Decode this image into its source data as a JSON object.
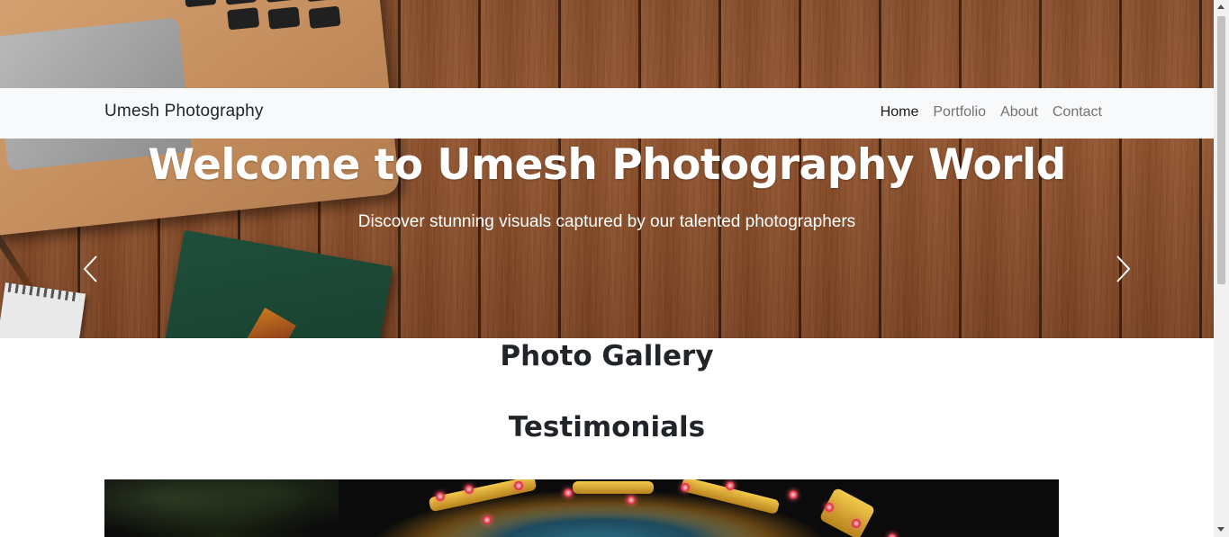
{
  "navbar": {
    "brand": "Umesh Photography",
    "links": [
      {
        "label": "Home",
        "active": true
      },
      {
        "label": "Portfolio",
        "active": false
      },
      {
        "label": "About",
        "active": false
      },
      {
        "label": "Contact",
        "active": false
      }
    ]
  },
  "hero": {
    "title": "Welcome to Umesh Photography World",
    "subtitle": "Discover stunning visuals captured by our talented photographers",
    "prev_icon": "chevron-left-icon",
    "next_icon": "chevron-right-icon"
  },
  "sections": {
    "gallery_title": "Photo Gallery",
    "testimonials_title": "Testimonials"
  },
  "colors": {
    "navbar_bg": "#f8f9fa",
    "text_dark": "#212529",
    "nav_inactive": "rgba(0,0,0,0.55)",
    "hero_text": "#ffffff"
  }
}
